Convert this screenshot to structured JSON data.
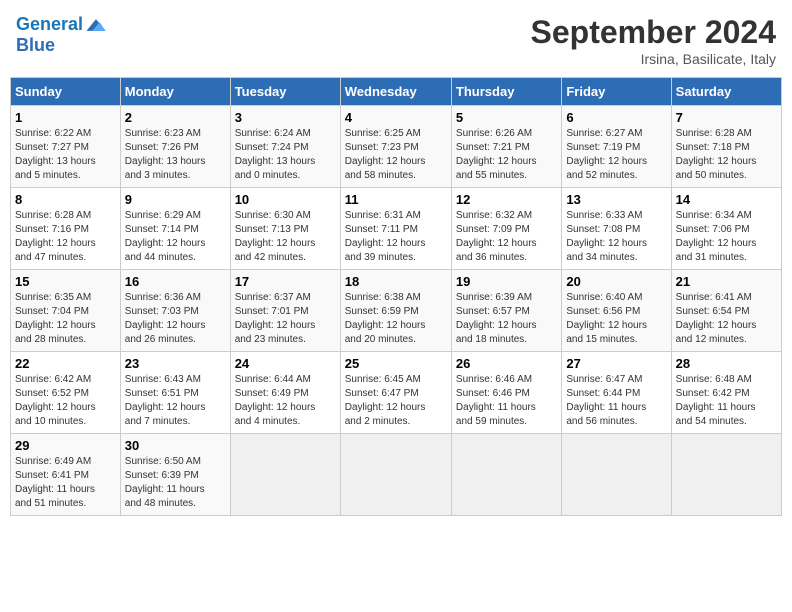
{
  "header": {
    "logo_line1": "General",
    "logo_line2": "Blue",
    "month": "September 2024",
    "location": "Irsina, Basilicate, Italy"
  },
  "weekdays": [
    "Sunday",
    "Monday",
    "Tuesday",
    "Wednesday",
    "Thursday",
    "Friday",
    "Saturday"
  ],
  "weeks": [
    [
      {
        "day": "1",
        "info": "Sunrise: 6:22 AM\nSunset: 7:27 PM\nDaylight: 13 hours\nand 5 minutes."
      },
      {
        "day": "2",
        "info": "Sunrise: 6:23 AM\nSunset: 7:26 PM\nDaylight: 13 hours\nand 3 minutes."
      },
      {
        "day": "3",
        "info": "Sunrise: 6:24 AM\nSunset: 7:24 PM\nDaylight: 13 hours\nand 0 minutes."
      },
      {
        "day": "4",
        "info": "Sunrise: 6:25 AM\nSunset: 7:23 PM\nDaylight: 12 hours\nand 58 minutes."
      },
      {
        "day": "5",
        "info": "Sunrise: 6:26 AM\nSunset: 7:21 PM\nDaylight: 12 hours\nand 55 minutes."
      },
      {
        "day": "6",
        "info": "Sunrise: 6:27 AM\nSunset: 7:19 PM\nDaylight: 12 hours\nand 52 minutes."
      },
      {
        "day": "7",
        "info": "Sunrise: 6:28 AM\nSunset: 7:18 PM\nDaylight: 12 hours\nand 50 minutes."
      }
    ],
    [
      {
        "day": "8",
        "info": "Sunrise: 6:28 AM\nSunset: 7:16 PM\nDaylight: 12 hours\nand 47 minutes."
      },
      {
        "day": "9",
        "info": "Sunrise: 6:29 AM\nSunset: 7:14 PM\nDaylight: 12 hours\nand 44 minutes."
      },
      {
        "day": "10",
        "info": "Sunrise: 6:30 AM\nSunset: 7:13 PM\nDaylight: 12 hours\nand 42 minutes."
      },
      {
        "day": "11",
        "info": "Sunrise: 6:31 AM\nSunset: 7:11 PM\nDaylight: 12 hours\nand 39 minutes."
      },
      {
        "day": "12",
        "info": "Sunrise: 6:32 AM\nSunset: 7:09 PM\nDaylight: 12 hours\nand 36 minutes."
      },
      {
        "day": "13",
        "info": "Sunrise: 6:33 AM\nSunset: 7:08 PM\nDaylight: 12 hours\nand 34 minutes."
      },
      {
        "day": "14",
        "info": "Sunrise: 6:34 AM\nSunset: 7:06 PM\nDaylight: 12 hours\nand 31 minutes."
      }
    ],
    [
      {
        "day": "15",
        "info": "Sunrise: 6:35 AM\nSunset: 7:04 PM\nDaylight: 12 hours\nand 28 minutes."
      },
      {
        "day": "16",
        "info": "Sunrise: 6:36 AM\nSunset: 7:03 PM\nDaylight: 12 hours\nand 26 minutes."
      },
      {
        "day": "17",
        "info": "Sunrise: 6:37 AM\nSunset: 7:01 PM\nDaylight: 12 hours\nand 23 minutes."
      },
      {
        "day": "18",
        "info": "Sunrise: 6:38 AM\nSunset: 6:59 PM\nDaylight: 12 hours\nand 20 minutes."
      },
      {
        "day": "19",
        "info": "Sunrise: 6:39 AM\nSunset: 6:57 PM\nDaylight: 12 hours\nand 18 minutes."
      },
      {
        "day": "20",
        "info": "Sunrise: 6:40 AM\nSunset: 6:56 PM\nDaylight: 12 hours\nand 15 minutes."
      },
      {
        "day": "21",
        "info": "Sunrise: 6:41 AM\nSunset: 6:54 PM\nDaylight: 12 hours\nand 12 minutes."
      }
    ],
    [
      {
        "day": "22",
        "info": "Sunrise: 6:42 AM\nSunset: 6:52 PM\nDaylight: 12 hours\nand 10 minutes."
      },
      {
        "day": "23",
        "info": "Sunrise: 6:43 AM\nSunset: 6:51 PM\nDaylight: 12 hours\nand 7 minutes."
      },
      {
        "day": "24",
        "info": "Sunrise: 6:44 AM\nSunset: 6:49 PM\nDaylight: 12 hours\nand 4 minutes."
      },
      {
        "day": "25",
        "info": "Sunrise: 6:45 AM\nSunset: 6:47 PM\nDaylight: 12 hours\nand 2 minutes."
      },
      {
        "day": "26",
        "info": "Sunrise: 6:46 AM\nSunset: 6:46 PM\nDaylight: 11 hours\nand 59 minutes."
      },
      {
        "day": "27",
        "info": "Sunrise: 6:47 AM\nSunset: 6:44 PM\nDaylight: 11 hours\nand 56 minutes."
      },
      {
        "day": "28",
        "info": "Sunrise: 6:48 AM\nSunset: 6:42 PM\nDaylight: 11 hours\nand 54 minutes."
      }
    ],
    [
      {
        "day": "29",
        "info": "Sunrise: 6:49 AM\nSunset: 6:41 PM\nDaylight: 11 hours\nand 51 minutes."
      },
      {
        "day": "30",
        "info": "Sunrise: 6:50 AM\nSunset: 6:39 PM\nDaylight: 11 hours\nand 48 minutes."
      },
      {
        "day": "",
        "info": ""
      },
      {
        "day": "",
        "info": ""
      },
      {
        "day": "",
        "info": ""
      },
      {
        "day": "",
        "info": ""
      },
      {
        "day": "",
        "info": ""
      }
    ]
  ]
}
